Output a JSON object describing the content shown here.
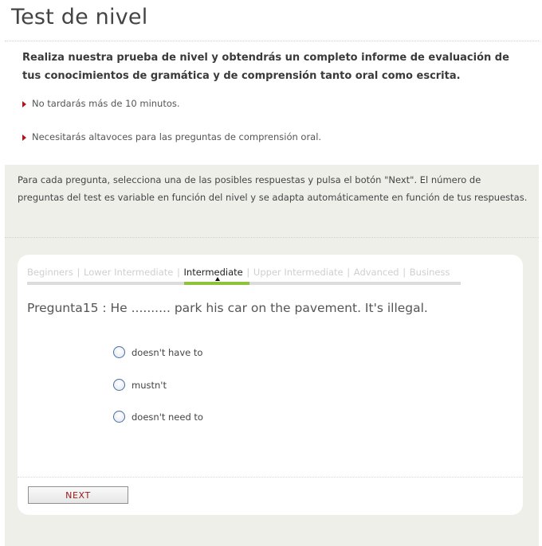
{
  "page": {
    "title": "Test de nivel"
  },
  "intro": {
    "text": "Realiza nuestra prueba de nivel y obtendrás un completo informe de evaluación de tus conocimientos de gramática y de comprensión tanto oral como escrita.",
    "bullets": [
      "No tardarás más de 10 minutos.",
      "Necesitarás altavoces para las preguntas de comprensión oral."
    ]
  },
  "instructions": "Para cada pregunta, selecciona una de las posibles respuestas y pulsa el botón \"Next\". El número de preguntas del test es variable en función del nivel y se adapta automáticamente en función de tus respuestas.",
  "levels": {
    "items": [
      "Beginners",
      "Lower Intermediate",
      "Intermediate",
      "Upper Intermediate",
      "Advanced",
      "Business"
    ],
    "separator": "|",
    "active": "Intermediate"
  },
  "question": {
    "text": "Pregunta15 : He .......... park his car on the pavement. It's illegal.",
    "options": [
      "doesn't have to",
      "mustn't",
      "doesn't need to"
    ]
  },
  "next_button": {
    "label": "NEXT"
  },
  "colors": {
    "accent_red": "#b3131d",
    "level_active_bar": "#8ec23a",
    "panel_bg": "#efefea"
  }
}
